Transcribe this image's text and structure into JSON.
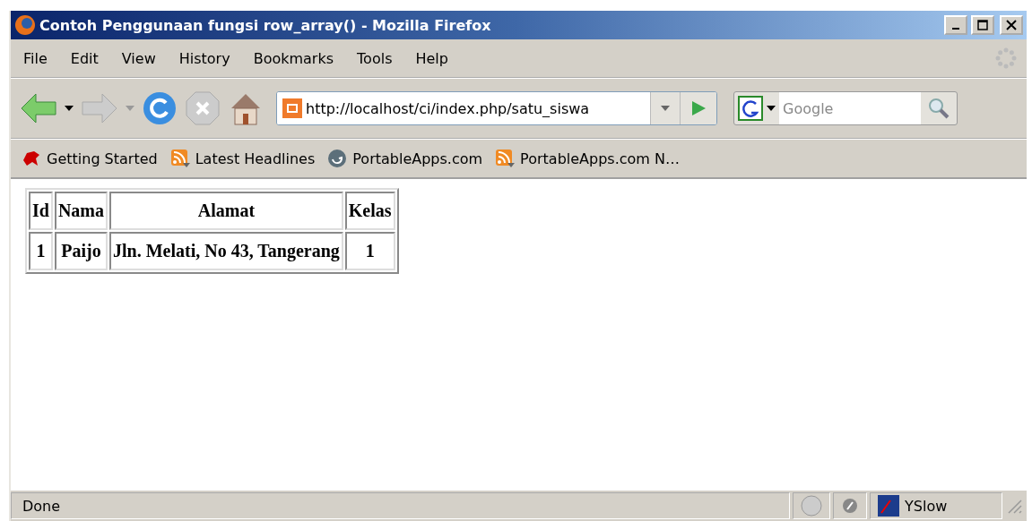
{
  "window": {
    "title": "Contoh Penggunaan fungsi row_array() - Mozilla Firefox"
  },
  "menu": [
    "File",
    "Edit",
    "View",
    "History",
    "Bookmarks",
    "Tools",
    "Help"
  ],
  "address_bar": {
    "value": "http://localhost/ci/index.php/satu_siswa"
  },
  "search": {
    "placeholder": "Google"
  },
  "bookmarks": [
    {
      "label": "Getting Started",
      "kind": "page"
    },
    {
      "label": "Latest Headlines",
      "kind": "feed"
    },
    {
      "label": "PortableApps.com",
      "kind": "site"
    },
    {
      "label": "PortableApps.com N…",
      "kind": "feed"
    }
  ],
  "table": {
    "columns": [
      "Id",
      "Nama",
      "Alamat",
      "Kelas"
    ],
    "rows": [
      [
        "1",
        "Paijo",
        "Jln. Melati, No 43, Tangerang",
        "1"
      ]
    ]
  },
  "status_bar": {
    "text": "Done",
    "extension": "YSlow"
  }
}
